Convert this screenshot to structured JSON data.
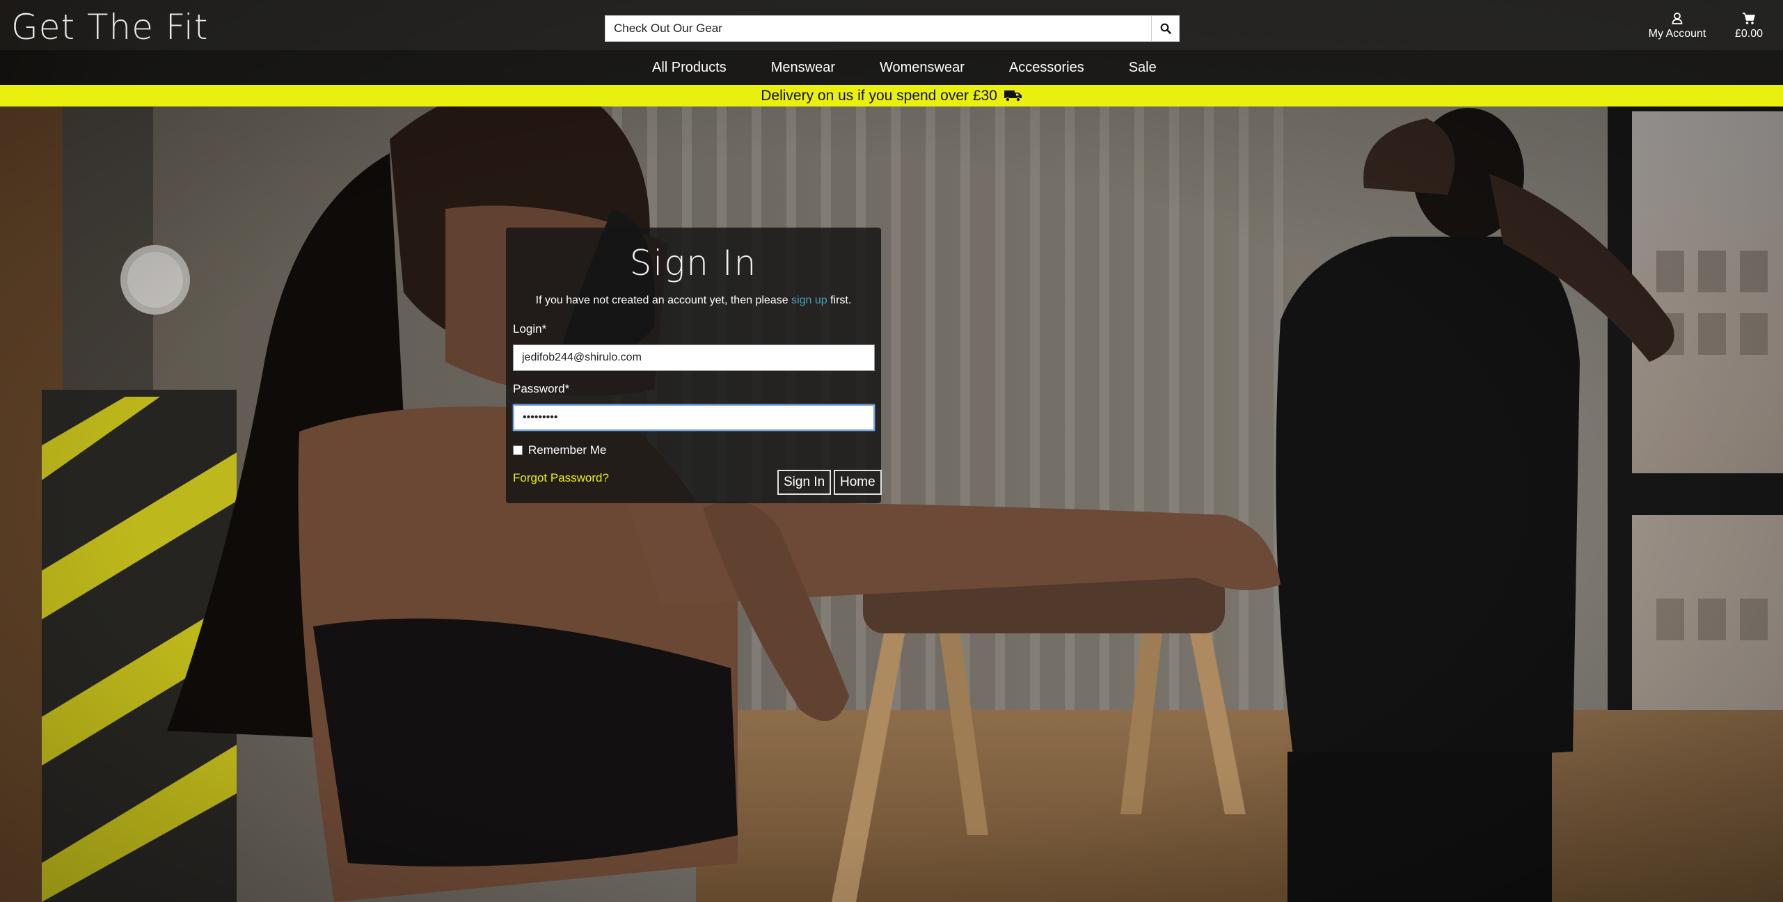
{
  "header": {
    "logo": "Get The Fit",
    "search": {
      "placeholder": "Check Out Our Gear",
      "value": ""
    },
    "account_label": "My Account",
    "cart_total": "£0.00"
  },
  "nav": {
    "items": [
      {
        "label": "All Products"
      },
      {
        "label": "Menswear"
      },
      {
        "label": "Womenswear"
      },
      {
        "label": "Accessories"
      },
      {
        "label": "Sale"
      }
    ]
  },
  "banner": {
    "text": "Delivery on us if you spend over £30",
    "icon": "truck-icon",
    "color": "#eaf00d"
  },
  "signin": {
    "title": "Sign In",
    "intro_before": "If you have not created an account yet, then please",
    "signup_link": "sign up",
    "intro_after": "first.",
    "login_label": "Login*",
    "login_value": "jedifob244@shirulo.com",
    "password_label": "Password*",
    "password_value": "•••••••••",
    "remember_label": "Remember Me",
    "remember_checked": false,
    "forgot_label": "Forgot Password?",
    "signin_button": "Sign In",
    "home_button": "Home"
  },
  "colors": {
    "accent_yellow": "#e9ee1e",
    "link_blue": "#4aa3b8"
  }
}
